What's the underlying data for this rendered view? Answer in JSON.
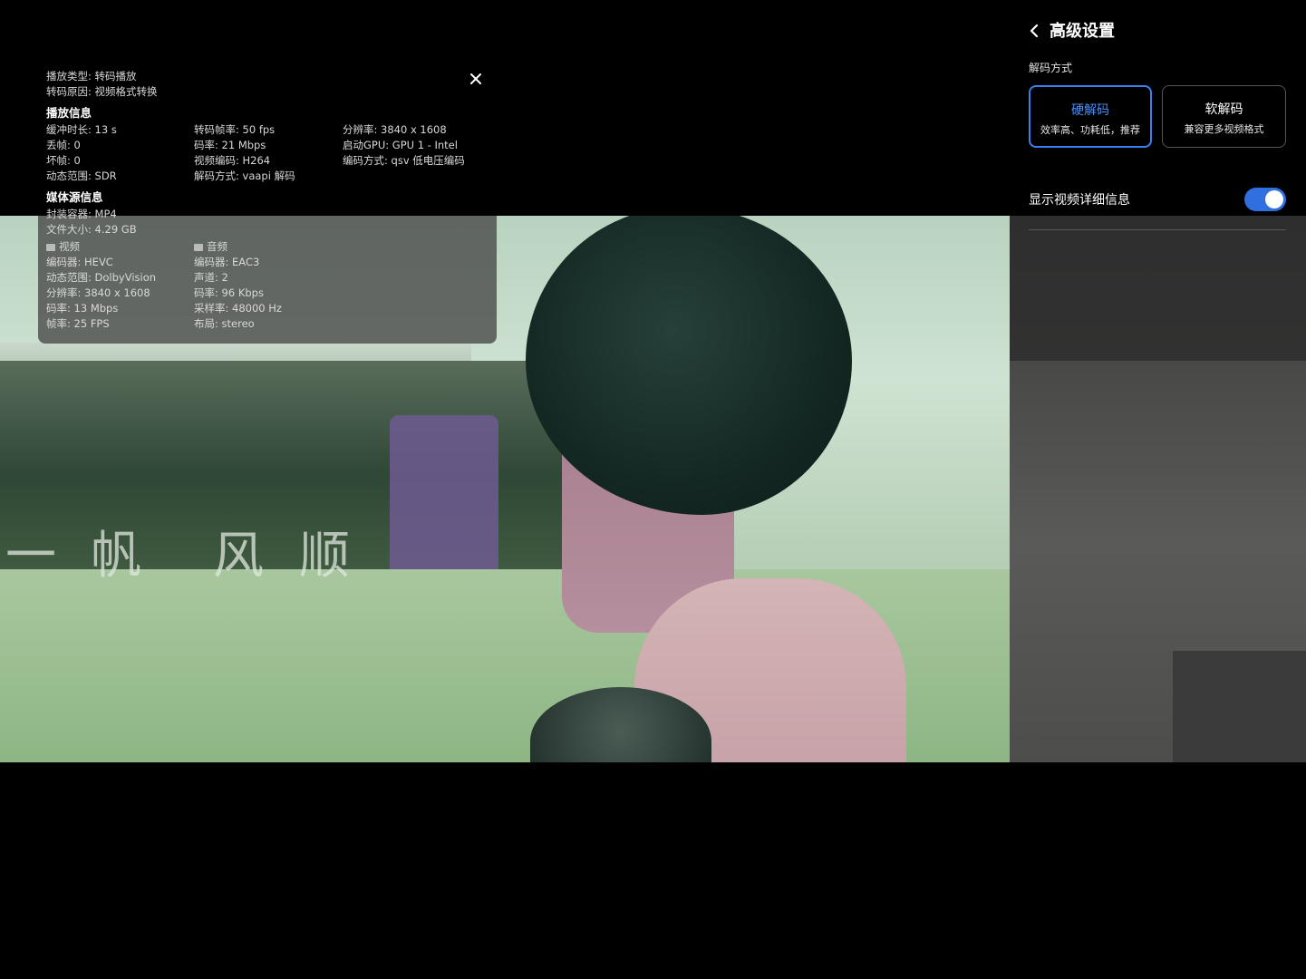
{
  "overlay": {
    "play_type": "播放类型: 转码播放",
    "transcode_reason": "转码原因: 视频格式转换",
    "play_info_title": "播放信息",
    "play_info": {
      "col1": [
        "缓冲时长: 13 s",
        "丢帧: 0",
        "坏帧: 0",
        "动态范围: SDR"
      ],
      "col2": [
        "转码帧率: 50 fps",
        "码率: 21 Mbps",
        "视频编码: H264",
        "解码方式: vaapi 解码"
      ],
      "col3": [
        "分辨率: 3840 x 1608",
        "启动GPU: GPU 1 - Intel",
        "编码方式: qsv 低电压编码"
      ]
    },
    "media_info_title": "媒体源信息",
    "container": "封装容器: MP4",
    "file_size": "文件大小: 4.29 GB",
    "video_header": "视频",
    "audio_header": "音频",
    "video": [
      "编码器: HEVC",
      "动态范围: DolbyVision",
      "分辨率: 3840 x 1608",
      "码率: 13 Mbps",
      "帧率: 25 FPS"
    ],
    "audio": [
      "编码器: EAC3",
      "声道:  2",
      "码率: 96 Kbps",
      "采样率: 48000 Hz",
      "布局: stereo"
    ],
    "close_icon": "close-icon"
  },
  "settings": {
    "title": "高级设置",
    "decode_label": "解码方式",
    "hw_title": "硬解码",
    "hw_sub": "效率高、功耗低，推荐",
    "sw_title": "软解码",
    "sw_sub": "兼容更多视频格式",
    "detail_label": "显示视频详细信息",
    "detail_enabled": true,
    "accent_color": "#3a7ff0"
  },
  "watermark_chars": [
    "一",
    "帆",
    "风",
    "顺"
  ]
}
